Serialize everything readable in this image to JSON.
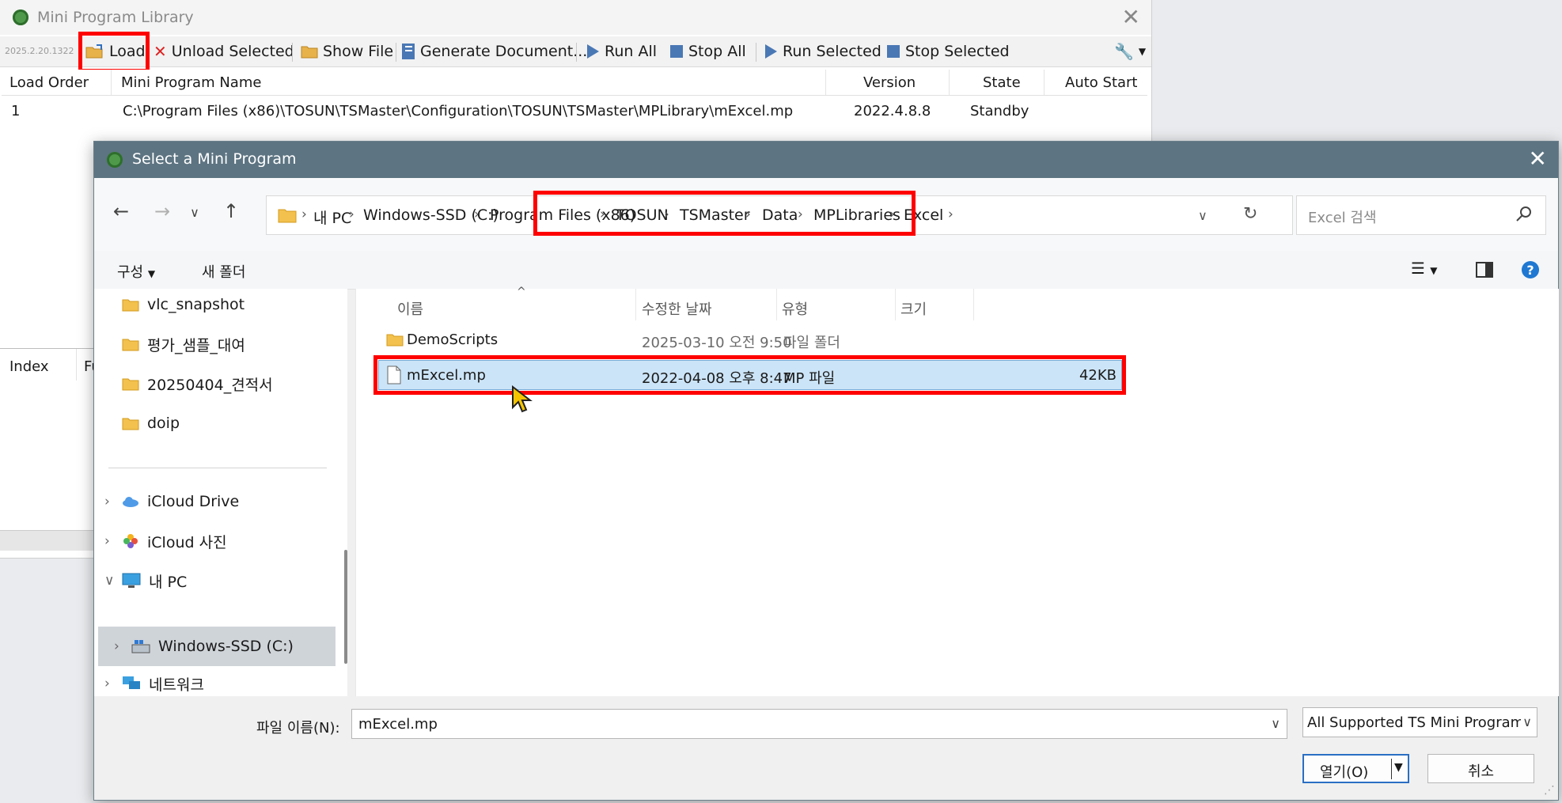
{
  "bg_window": {
    "title": "Mini Program Library",
    "version_small": "2025.2.20.1322",
    "toolbar": {
      "load": "Load",
      "unload_selected": "Unload Selected",
      "show_file": "Show File",
      "generate_document": "Generate Document...",
      "run_all": "Run All",
      "stop_all": "Stop All",
      "run_selected": "Run Selected",
      "stop_selected": "Stop Selected"
    },
    "columns": [
      "Load Order",
      "Mini Program Name",
      "Version",
      "State",
      "Auto Start"
    ],
    "rows": [
      {
        "order": "1",
        "name": "C:\\Program Files (x86)\\TOSUN\\TSMaster\\Configuration\\TOSUN\\TSMaster\\MPLibrary\\mExcel.mp",
        "version": "2022.4.8.8",
        "state": "Standby",
        "auto_start": ""
      }
    ],
    "lower_columns": [
      "Index",
      "Fu"
    ]
  },
  "dialog": {
    "title": "Select a Mini Program",
    "breadcrumb": [
      "내 PC",
      "Windows-SSD (C:)",
      "Program Files (x86)",
      "TOSUN",
      "TSMaster",
      "Data",
      "MPLibraries",
      "Excel"
    ],
    "search_placeholder": "Excel 검색",
    "commands": {
      "organize": "구성",
      "new_folder": "새 폴더"
    },
    "nav_items": [
      {
        "label": "vlc_snapshot",
        "icon": "folder-icon"
      },
      {
        "label": "평가_샘플_대여",
        "icon": "folder-icon"
      },
      {
        "label": "20250404_견적서",
        "icon": "folder-icon"
      },
      {
        "label": "doip",
        "icon": "folder-icon"
      },
      {
        "label": "iCloud Drive",
        "icon": "icloud-icon"
      },
      {
        "label": "iCloud 사진",
        "icon": "icloud-photos-icon"
      },
      {
        "label": "내 PC",
        "icon": "pc-icon"
      },
      {
        "label": "Windows-SSD (C:)",
        "icon": "drive-icon"
      },
      {
        "label": "네트워크",
        "icon": "network-icon"
      }
    ],
    "file_columns": {
      "name": "이름",
      "modified": "수정한 날짜",
      "type": "유형",
      "size": "크기"
    },
    "files": [
      {
        "name": "DemoScripts",
        "modified": "2025-03-10 오전 9:50",
        "type": "파일 폴더",
        "size": ""
      },
      {
        "name": "mExcel.mp",
        "modified": "2022-04-08 오후 8:47",
        "type": "MP 파일",
        "size": "42KB"
      }
    ],
    "filename_label": "파일 이름(N):",
    "filename_value": "mExcel.mp",
    "filetype_value": "All Supported TS Mini Program",
    "open_button": "열기(O)",
    "cancel_button": "취소"
  },
  "colors": {
    "highlight": "#ff0000",
    "dialog_title_bg": "#5d7482",
    "selection": "#cce4f7",
    "toolbar_blue": "#4a78b5"
  }
}
